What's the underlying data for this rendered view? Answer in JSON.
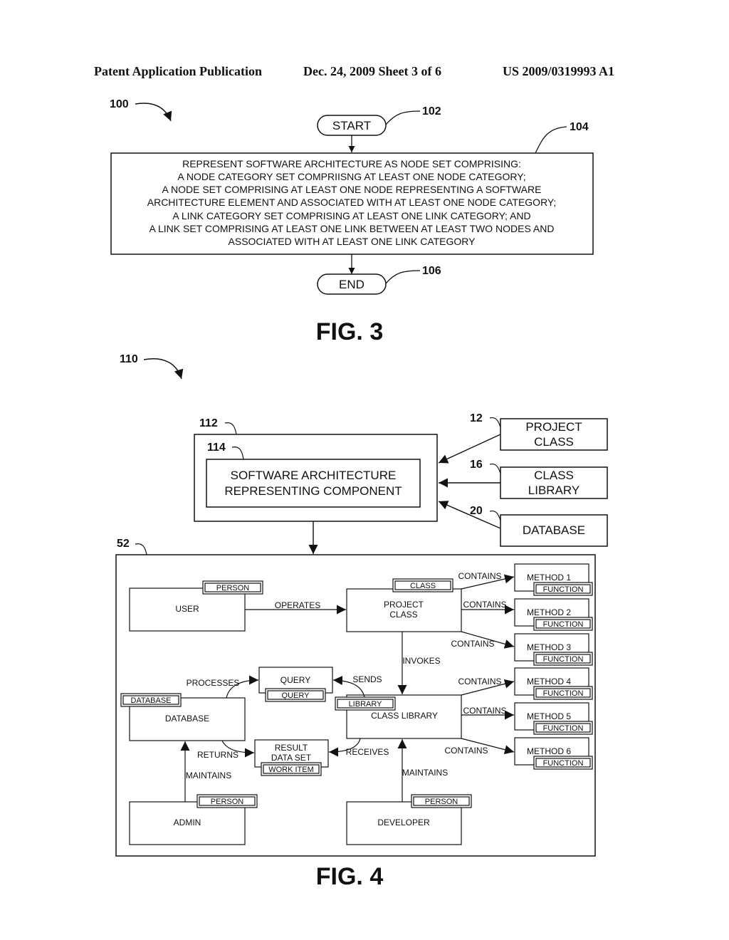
{
  "header": {
    "publication": "Patent Application Publication",
    "date_sheet": "Dec. 24, 2009   Sheet 3 of 6",
    "number": "US 2009/0319993 A1"
  },
  "fig3": {
    "caption": "FIG. 3",
    "ref_flow": "100",
    "start": {
      "label": "START",
      "ref": "102"
    },
    "process": {
      "ref": "104",
      "lines": [
        "REPRESENT SOFTWARE ARCHITECTURE AS NODE SET COMPRISING:",
        "A NODE CATEGORY SET COMPRIISNG AT LEAST ONE NODE CATEGORY;",
        "A NODE SET COMPRISING AT LEAST ONE NODE REPRESENTING A SOFTWARE",
        "ARCHITECTURE ELEMENT AND ASSOCIATED WITH AT LEAST ONE NODE CATEGORY;",
        "A LINK CATEGORY SET COMPRISING AT LEAST ONE LINK CATEGORY; AND",
        "A LINK SET COMPRISING AT LEAST ONE LINK BETWEEN AT LEAST TWO NODES AND",
        "ASSOCIATED WITH AT LEAST ONE LINK CATEGORY"
      ]
    },
    "end": {
      "label": "END",
      "ref": "106"
    }
  },
  "fig4": {
    "caption": "FIG. 4",
    "ref_system": "110",
    "outer": {
      "ref": "112"
    },
    "component": {
      "ref": "114",
      "line1": "SOFTWARE ARCHITECTURE",
      "line2": "REPRESENTING COMPONENT"
    },
    "inputs": [
      {
        "ref": "12",
        "line1": "PROJECT",
        "line2": "CLASS"
      },
      {
        "ref": "16",
        "line1": "CLASS",
        "line2": "LIBRARY"
      },
      {
        "ref": "20",
        "line1": "DATABASE",
        "line2": ""
      }
    ],
    "graph": {
      "ref": "52",
      "nodes": {
        "user": {
          "name": "USER",
          "category": "PERSON"
        },
        "project_class": {
          "name1": "PROJECT",
          "name2": "CLASS",
          "category": "CLASS"
        },
        "query": {
          "name": "QUERY",
          "category": "QUERY"
        },
        "database": {
          "name": "DATABASE",
          "category": "DATABASE"
        },
        "class_library": {
          "name": "CLASS LIBRARY",
          "category": "LIBRARY"
        },
        "result": {
          "name1": "RESULT",
          "name2": "DATA SET",
          "category": "WORK ITEM"
        },
        "admin": {
          "name": "ADMIN",
          "category": "PERSON"
        },
        "developer": {
          "name": "DEVELOPER",
          "category": "PERSON"
        },
        "methods": [
          {
            "name": "METHOD 1",
            "category": "FUNCTION"
          },
          {
            "name": "METHOD 2",
            "category": "FUNCTION"
          },
          {
            "name": "METHOD 3",
            "category": "FUNCTION"
          },
          {
            "name": "METHOD 4",
            "category": "FUNCTION"
          },
          {
            "name": "METHOD 5",
            "category": "FUNCTION"
          },
          {
            "name": "METHOD 6",
            "category": "FUNCTION"
          }
        ]
      },
      "links": {
        "operates": "OPERATES",
        "contains": "CONTAINS",
        "invokes": "INVOKES",
        "processes": "PROCESSES",
        "sends": "SENDS",
        "returns": "RETURNS",
        "receives": "RECEIVES",
        "maintains": "MAINTAINS"
      }
    }
  }
}
